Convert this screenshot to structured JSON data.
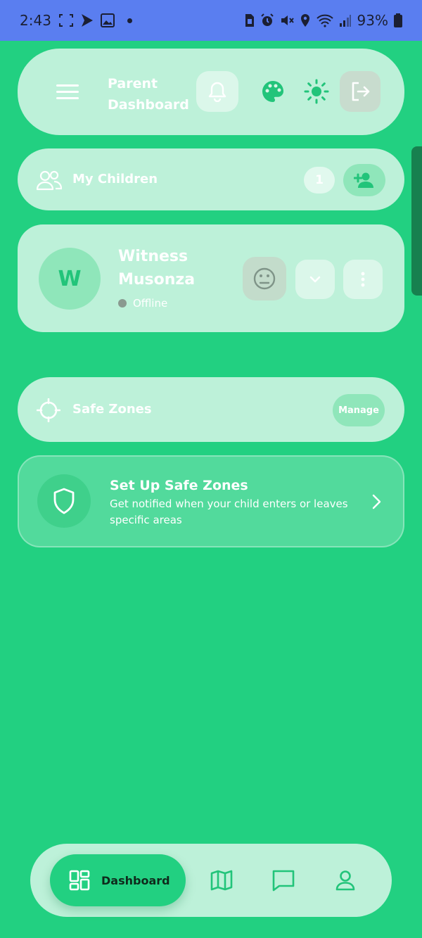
{
  "status_bar": {
    "time": "2:43",
    "battery": "93%"
  },
  "header": {
    "title": "Parent Dashboard"
  },
  "children_section": {
    "label": "My Children",
    "count": "1"
  },
  "child": {
    "initial": "W",
    "name": "Witness Musonza",
    "status": "Offline"
  },
  "safe_zones": {
    "label": "Safe Zones",
    "manage_label": "Manage"
  },
  "setup_card": {
    "title": "Set Up Safe Zones",
    "description": "Get notified when your child enters or leaves specific areas"
  },
  "bottom_nav": {
    "active_label": "Dashboard",
    "items": [
      "dashboard-icon",
      "map-icon",
      "chat-icon",
      "profile-icon"
    ]
  },
  "colors": {
    "background": "#22d081",
    "status_bar": "#5a7ef0",
    "accent": "#22c47a"
  }
}
